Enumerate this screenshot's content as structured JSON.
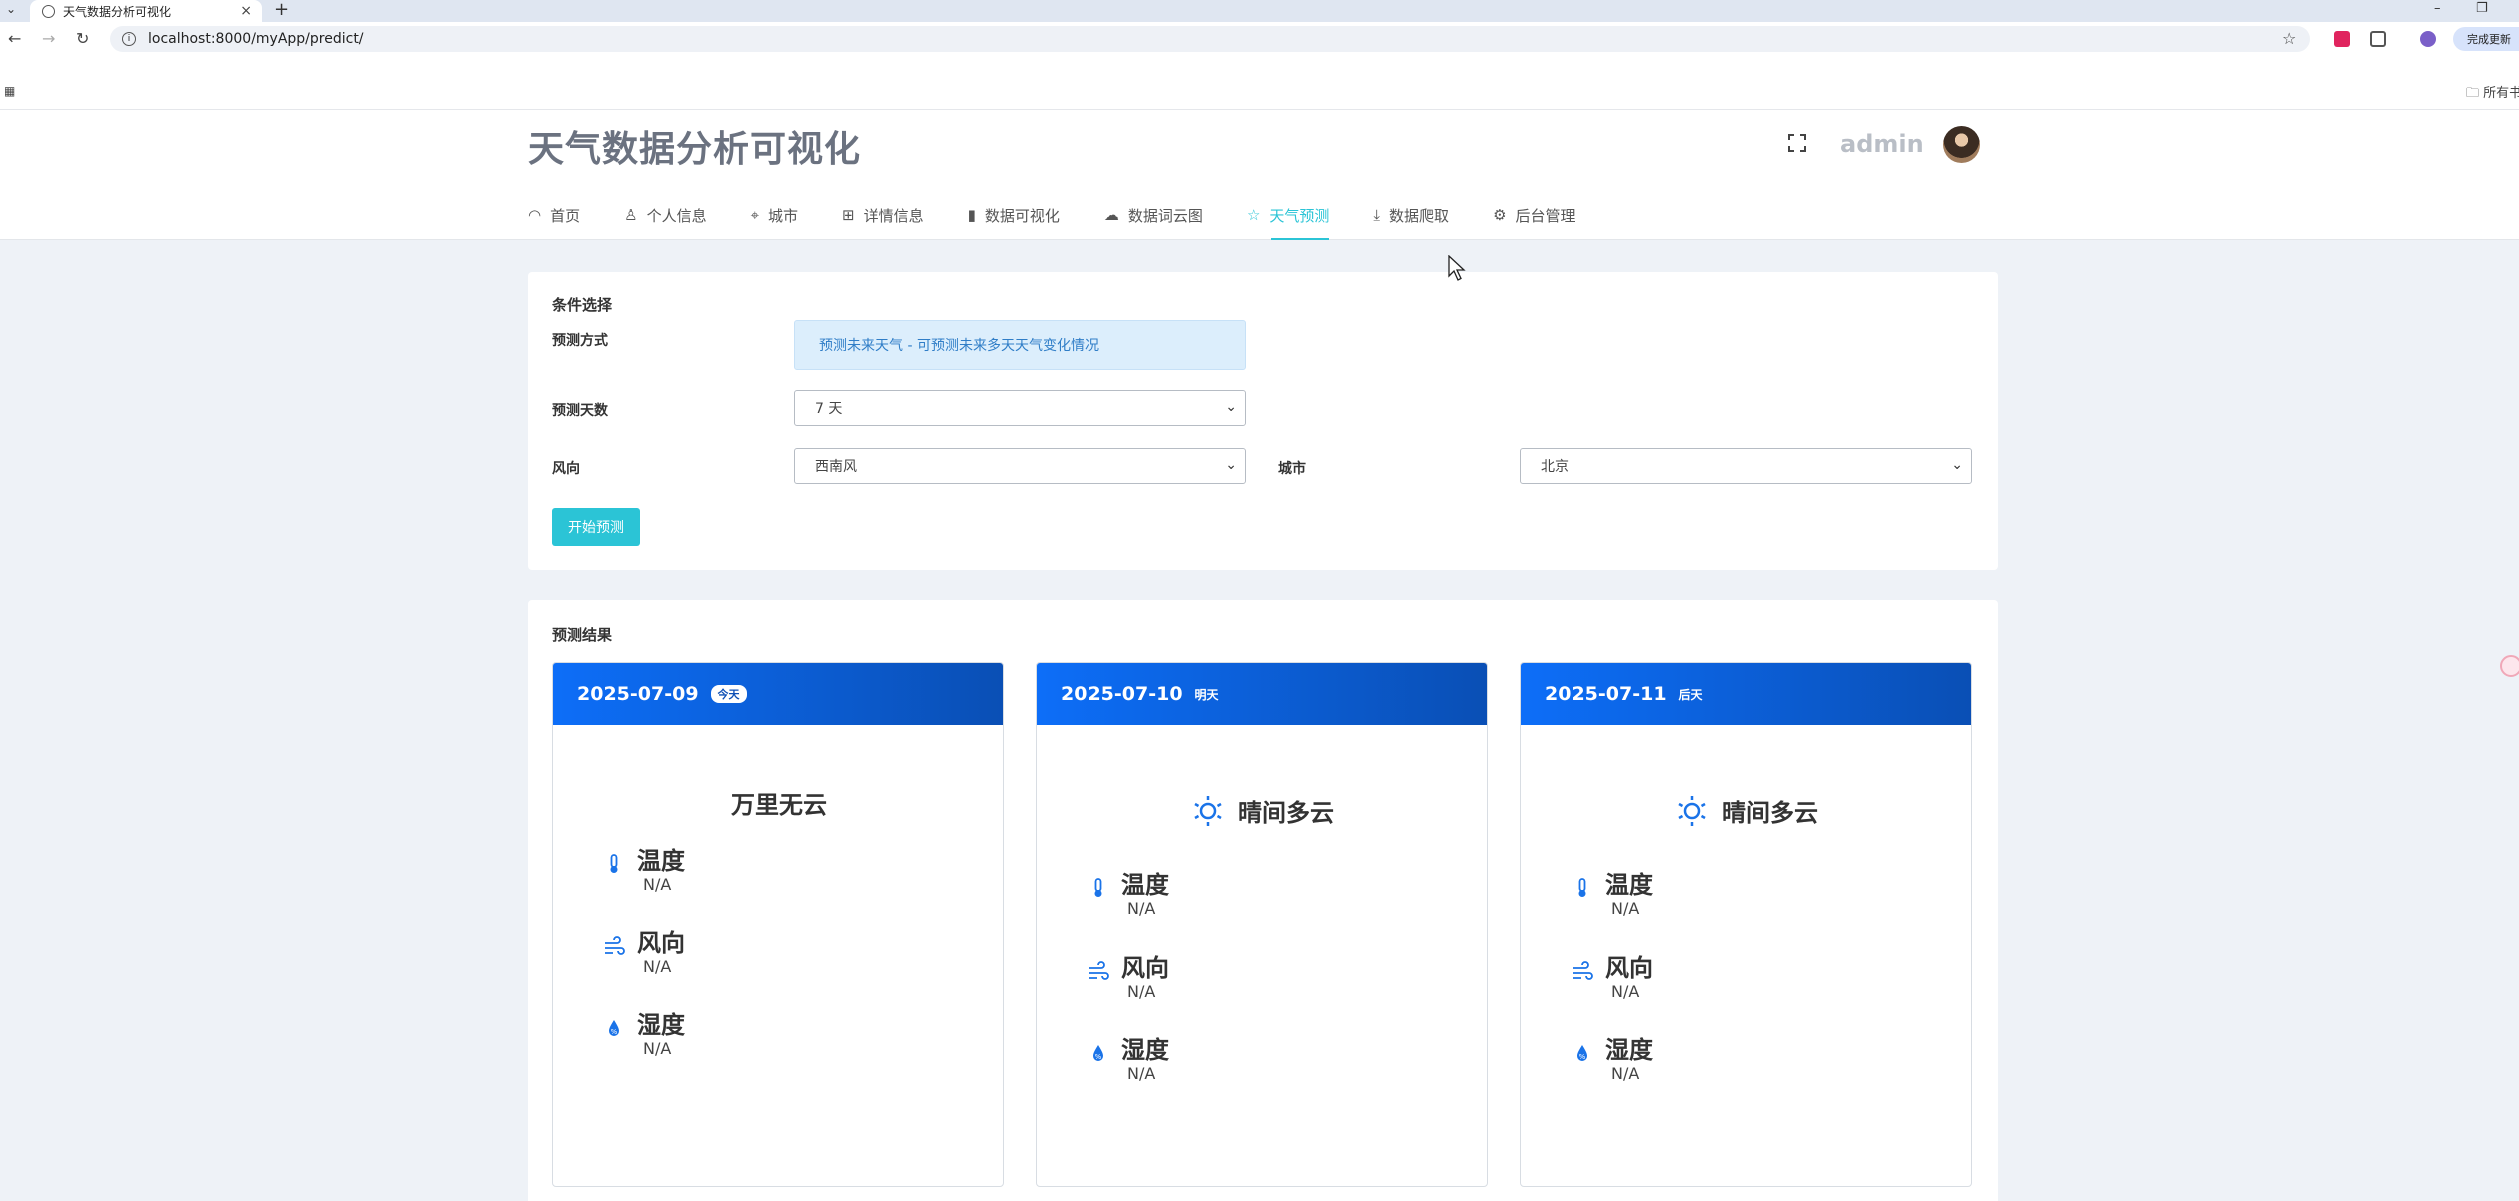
{
  "browser": {
    "tab_title": "天气数据分析可视化",
    "url": "localhost:8000/myApp/predict/",
    "update_label": "完成更新",
    "all_bookmarks_label": "所有书签"
  },
  "header": {
    "title": "天气数据分析可视化",
    "username": "admin"
  },
  "nav": [
    {
      "label": "首页",
      "icon": "dashboard-gauge-icon"
    },
    {
      "label": "个人信息",
      "icon": "user-icon"
    },
    {
      "label": "城市",
      "icon": "location-pin-icon"
    },
    {
      "label": "详情信息",
      "icon": "grid-icon"
    },
    {
      "label": "数据可视化",
      "icon": "bar-chart-icon"
    },
    {
      "label": "数据词云图",
      "icon": "cloud-icon"
    },
    {
      "label": "天气预测",
      "icon": "star-icon",
      "active": true
    },
    {
      "label": "数据爬取",
      "icon": "download-icon"
    },
    {
      "label": "后台管理",
      "icon": "gear-icon"
    }
  ],
  "conditions": {
    "title": "条件选择",
    "method_label": "预测方式",
    "method_value": "预测未来天气 - 可预测未来多天天气变化情况",
    "days_label": "预测天数",
    "days_value": "7 天",
    "wind_label": "风向",
    "wind_value": "西南风",
    "city_label": "城市",
    "city_value": "北京",
    "start_button": "开始预测"
  },
  "results": {
    "title": "预测结果",
    "forecasts": [
      {
        "date": "2025-07-09",
        "badge": "今天",
        "weather": "万里无云",
        "temp_label": "温度",
        "temp": "N/A",
        "wind_label": "风向",
        "wind": "N/A",
        "humidity_label": "湿度",
        "humidity": "N/A"
      },
      {
        "date": "2025-07-10",
        "badge": "明天",
        "weather": "晴间多云",
        "temp_label": "温度",
        "temp": "N/A",
        "wind_label": "风向",
        "wind": "N/A",
        "humidity_label": "湿度",
        "humidity": "N/A"
      },
      {
        "date": "2025-07-11",
        "badge": "后天",
        "weather": "晴间多云",
        "temp_label": "温度",
        "temp": "N/A",
        "wind_label": "风向",
        "wind": "N/A",
        "humidity_label": "湿度",
        "humidity": "N/A"
      }
    ]
  },
  "colors": {
    "accent": "#2bc4d6",
    "card_header_start": "#0d6ef8",
    "card_header_end": "#0a4fb5",
    "icon_blue": "#1a73e8"
  }
}
